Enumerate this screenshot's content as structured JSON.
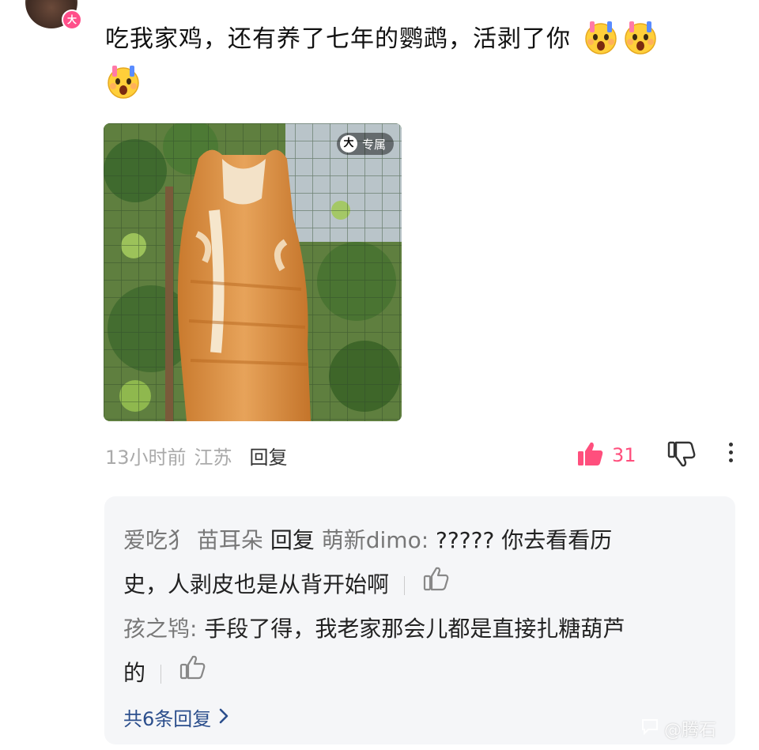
{
  "avatar": {
    "badge": "大"
  },
  "comment": {
    "text": "吃我家鸡，还有养了七年的鹦鹉，活剥了你",
    "emojis": [
      "shocked-face-icon",
      "shocked-face-icon",
      "shocked-face-icon"
    ],
    "image_badge": "专属",
    "image_badge_icon": "大",
    "time": "13小时前",
    "location": "江苏",
    "reply_label": "回复",
    "like_count": "31",
    "accent_color": "#ff4f7d"
  },
  "replies": [
    {
      "user": "爱吃犭 苗耳朵",
      "connector": "回复",
      "target": "萌新dimo:",
      "text_line1": "????? 你去看看历",
      "text_line2": "史，人剥皮也是从背开始啊"
    },
    {
      "user": "孩之鸨:",
      "text_line1": "手段了得，我老家那会儿都是直接扎糖葫芦",
      "text_line2": "的"
    }
  ],
  "more_replies": "共6条回复",
  "watermark": "@腾石"
}
